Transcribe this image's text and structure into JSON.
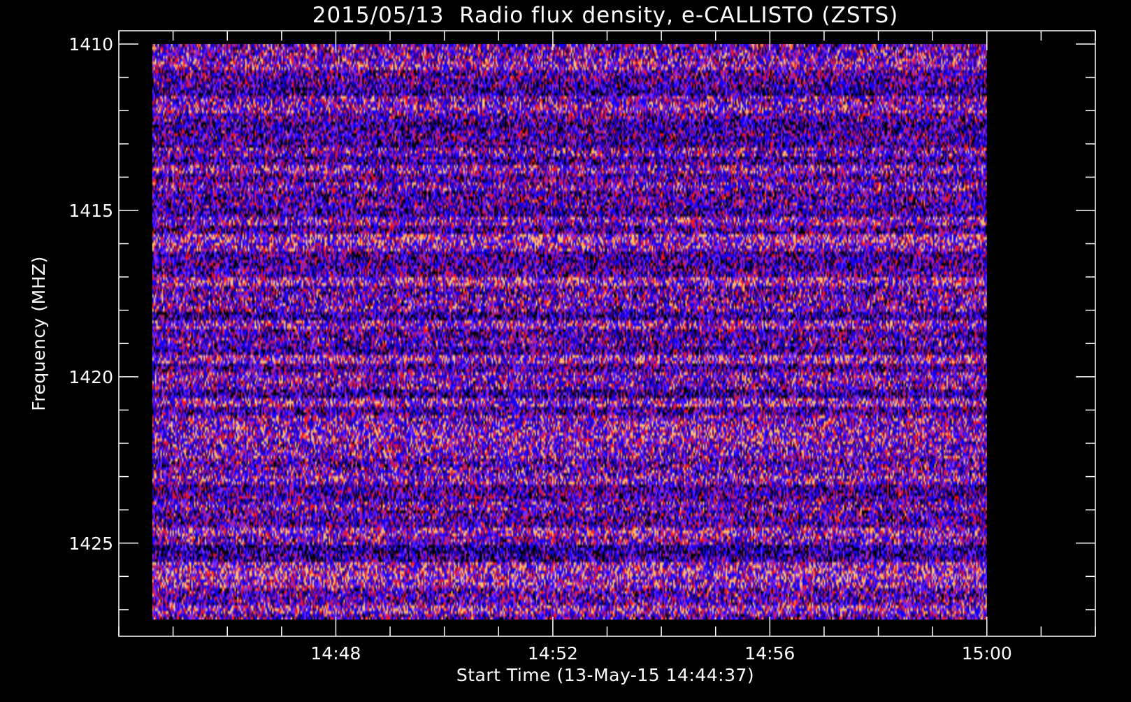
{
  "chart_data": {
    "type": "heatmap",
    "title": "2015/05/13  Radio flux density, e-CALLISTO (ZSTS)",
    "xlabel": "Start Time (13-May-15 14:44:37)",
    "ylabel": "Frequency (MHZ)",
    "x_range": [
      "14:44:37",
      "15:00:00"
    ],
    "y_range": [
      1427.3,
      1410.0
    ],
    "xlim": [
      "14:44:00",
      "15:02:00"
    ],
    "ylim": [
      1427.8,
      1409.6
    ],
    "x_ticks": [
      {
        "value": "14:48",
        "label": "14:48"
      },
      {
        "value": "14:52",
        "label": "14:52"
      },
      {
        "value": "14:56",
        "label": "14:56"
      },
      {
        "value": "15:00",
        "label": "15:00"
      }
    ],
    "x_minor_step_minutes": 1,
    "y_ticks": [
      {
        "value": 1410,
        "label": "1410"
      },
      {
        "value": 1415,
        "label": "1415"
      },
      {
        "value": 1420,
        "label": "1420"
      },
      {
        "value": 1425,
        "label": "1425"
      }
    ],
    "y_minor_step_mhz": 1,
    "colormap": [
      "#000000",
      "#35007a",
      "#1400ff",
      "#7a2cff",
      "#c01a5a",
      "#ff1414",
      "#ff7a3a",
      "#ffc070"
    ],
    "background_color": "#000000",
    "axis_color": "#ffffff",
    "grid": false,
    "legend": "none"
  }
}
